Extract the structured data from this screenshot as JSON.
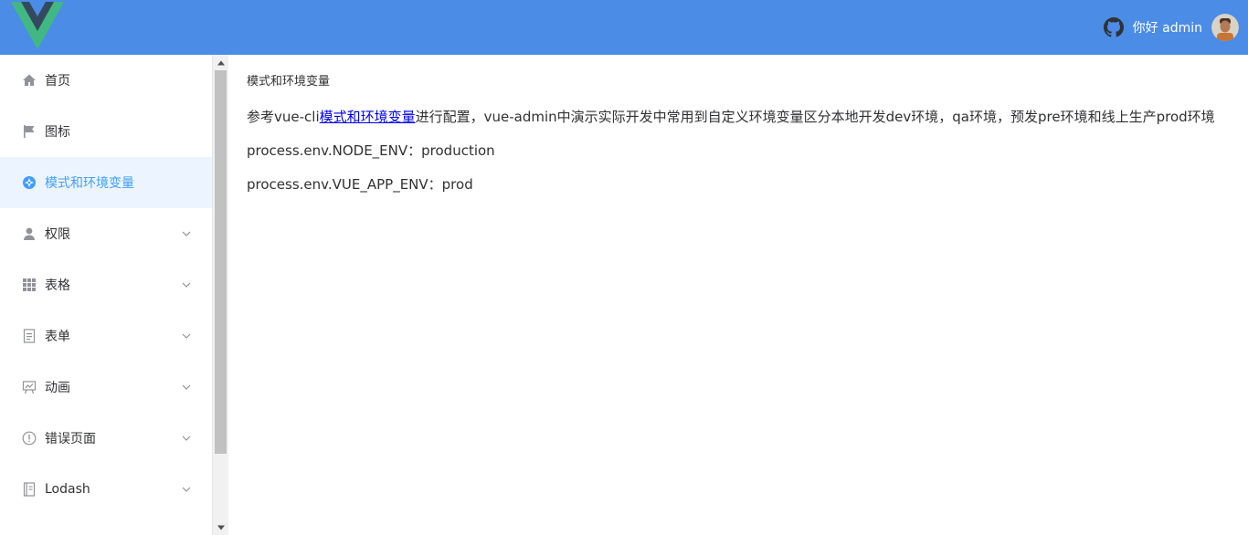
{
  "header": {
    "greeting": "你好 admin",
    "logo_icon": "vue-logo-icon",
    "github_icon": "github-icon",
    "bg_color": "#4a8ce6"
  },
  "sidebar": {
    "items": [
      {
        "label": "首页",
        "icon": "home-icon",
        "active": false,
        "has_children": false
      },
      {
        "label": "图标",
        "icon": "flag-icon",
        "active": false,
        "has_children": false
      },
      {
        "label": "模式和环境变量",
        "icon": "compass-icon",
        "active": true,
        "has_children": false
      },
      {
        "label": "权限",
        "icon": "user-icon",
        "active": false,
        "has_children": true
      },
      {
        "label": "表格",
        "icon": "grid-icon",
        "active": false,
        "has_children": true
      },
      {
        "label": "表单",
        "icon": "document-icon",
        "active": false,
        "has_children": true
      },
      {
        "label": "动画",
        "icon": "presentation-icon",
        "active": false,
        "has_children": true
      },
      {
        "label": "错误页面",
        "icon": "warning-icon",
        "active": false,
        "has_children": true
      },
      {
        "label": "Lodash",
        "icon": "notebook-icon",
        "active": false,
        "has_children": true
      }
    ],
    "active_color": "#409eff",
    "active_bg": "#ecf5ff"
  },
  "main": {
    "title": "模式和环境变量",
    "para_prefix": "参考vue-cli",
    "para_link": "模式和环境变量",
    "para_suffix": "进行配置，vue-admin中演示实际开发中常用到自定义环境变量区分本地开发dev环境，qa环境，预发pre环境和线上生产prod环境",
    "node_env": "process.env.NODE_ENV：production",
    "vue_app_env": "process.env.VUE_APP_ENV：prod"
  }
}
